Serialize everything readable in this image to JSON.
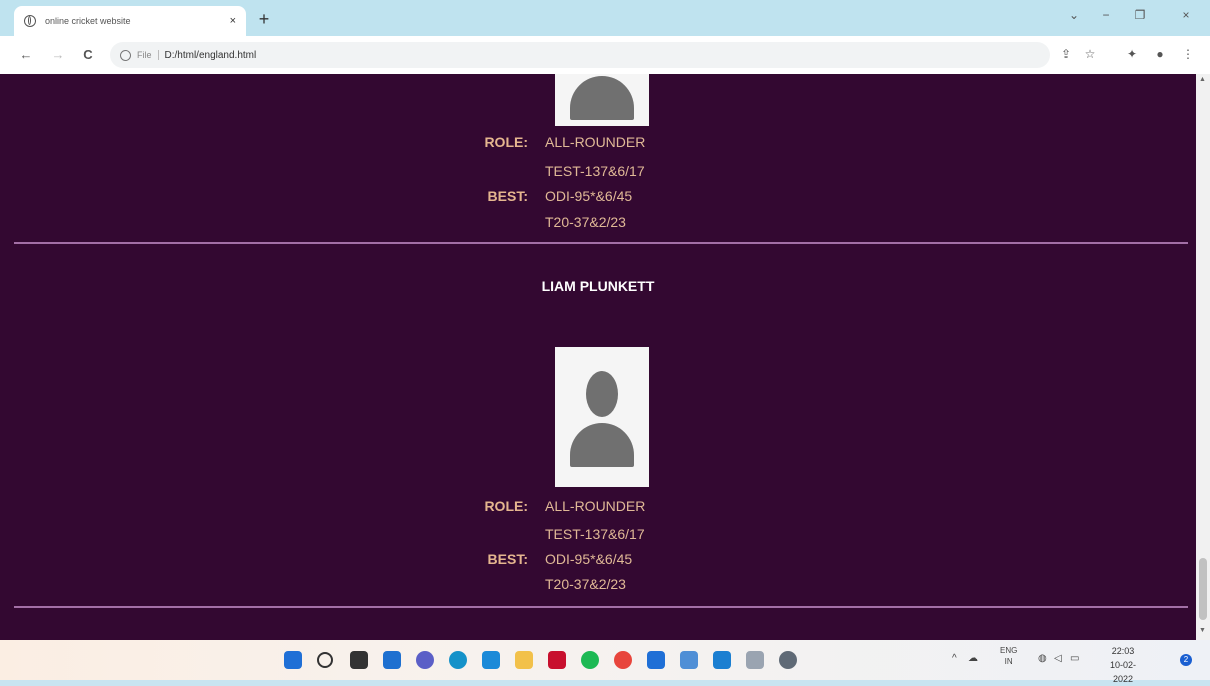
{
  "browser": {
    "tab_title": "online cricket website",
    "tab_close": "×",
    "new_tab": "+",
    "url_scheme": "File",
    "url": "D:/html/england.html",
    "controls": {
      "dropdown": "⌄",
      "minimize": "−",
      "restore": "❐",
      "close": "×"
    },
    "nav": {
      "back": "←",
      "forward": "→",
      "reload": "C"
    }
  },
  "players": [
    {
      "name": "",
      "role_label": "ROLE:",
      "role": "ALL-ROUNDER",
      "best_label": "BEST:",
      "best": [
        "TEST-137&6/17",
        "ODI-95*&6/45",
        "T20-37&2/23"
      ]
    },
    {
      "name": "LIAM PLUNKETT",
      "role_label": "ROLE:",
      "role": "ALL-ROUNDER",
      "best_label": "BEST:",
      "best": [
        "TEST-137&6/17",
        "ODI-95*&6/45",
        "T20-37&2/23"
      ]
    }
  ],
  "taskbar": {
    "language": "ENG",
    "region": "IN",
    "time": "22:03",
    "date": "10-02-2022",
    "notification_count": "2",
    "tray_chevron": "^",
    "apps": [
      {
        "name": "start-icon",
        "color": "#1f6fd6"
      },
      {
        "name": "search-icon",
        "color": "#333333"
      },
      {
        "name": "task-view-icon",
        "color": "#333333"
      },
      {
        "name": "widgets-icon",
        "color": "#1e70d0"
      },
      {
        "name": "chat-icon",
        "color": "#5b5fc7"
      },
      {
        "name": "edge-icon",
        "color": "#1592c9"
      },
      {
        "name": "store-icon",
        "color": "#1b8ad8"
      },
      {
        "name": "file-explorer-icon",
        "color": "#f2c14a"
      },
      {
        "name": "mcafee-icon",
        "color": "#c8102e"
      },
      {
        "name": "spotify-icon",
        "color": "#1db954"
      },
      {
        "name": "chrome-icon",
        "color": "#e8453c"
      },
      {
        "name": "mail-icon",
        "color": "#1f6fd6"
      },
      {
        "name": "notepad-icon",
        "color": "#4f8fd6"
      },
      {
        "name": "vscode-icon",
        "color": "#1b7fd1"
      },
      {
        "name": "document-icon",
        "color": "#9aa4b1"
      },
      {
        "name": "chrome-dev-icon",
        "color": "#5f6a76"
      }
    ]
  }
}
